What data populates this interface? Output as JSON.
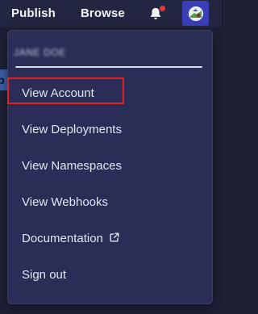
{
  "navbar": {
    "publish_label": "Publish",
    "browse_label": "Browse",
    "notification_icon": "bell-icon",
    "notification_indicator_color": "#e03a3a",
    "avatar_button_color": "#3a3fb8"
  },
  "peek": {
    "letter": "p"
  },
  "dropdown": {
    "user_name": "JANE DOE",
    "items": [
      {
        "label": "View Account"
      },
      {
        "label": "View Deployments"
      },
      {
        "label": "View Namespaces"
      },
      {
        "label": "View Webhooks"
      },
      {
        "label": "Documentation",
        "icon": "external-link-icon"
      },
      {
        "label": "Sign out"
      }
    ],
    "highlight_color": "#e02424"
  }
}
